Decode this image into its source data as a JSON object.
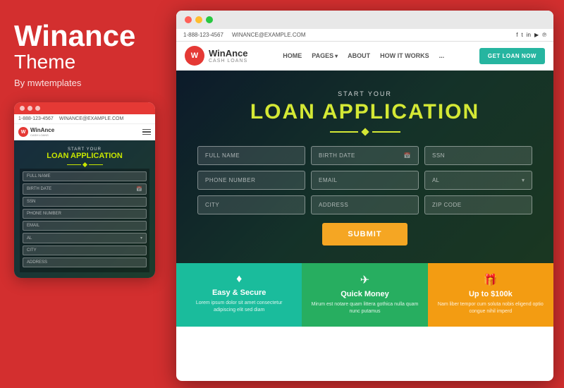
{
  "left": {
    "brand_title": "Winance",
    "brand_subtitle": "Theme",
    "by_text": "By mwtemplates"
  },
  "mobile": {
    "address_phone": "1-888-123-4567",
    "address_email": "WINANCE@EXAMPLE.COM",
    "logo_letter": "W",
    "logo_name": "WinAnce",
    "logo_sub": "CASH LOANS",
    "hero_start": "START YOUR",
    "hero_title": "LOAN APPLICATION",
    "fields": [
      "FULL NAME",
      "BIRTH DATE",
      "SSN",
      "PHONE NUMBER",
      "EMAIL",
      "AL",
      "CITY",
      "ADDRESS"
    ]
  },
  "browser": {
    "address_phone": "1-888-123-4567",
    "address_email": "WINANCE@EXAMPLE.COM",
    "social": [
      "f",
      "t",
      "in",
      "▶",
      "℗"
    ],
    "logo_letter": "W",
    "logo_name": "WinAnce",
    "logo_sub": "CASH LOANS",
    "nav_links": [
      "HOME",
      "PAGES",
      "ABOUT",
      "HOW IT WORKS",
      "..."
    ],
    "cta_label": "GET LOAN NOW",
    "hero_start": "START YOUR",
    "hero_title": "LOAN APPLICATION",
    "form": {
      "row1": [
        "FULL NAME",
        "BIRTH DATE",
        "SSN"
      ],
      "row2": [
        "PHONE NUMBER",
        "EMAIL",
        "AL"
      ],
      "row3": [
        "CITY",
        "ADDRESS",
        "ZIP CODE"
      ],
      "submit": "SUBMIT"
    },
    "cards": [
      {
        "icon": "♦",
        "title": "Easy & Secure",
        "text": "Lorem ipsum dolor sit amet consectetur adipiscing elit sed diam",
        "color": "teal"
      },
      {
        "icon": "✈",
        "title": "Quick Money",
        "text": "Mirum est notare quam littera gothica nulla quam nunc putamus",
        "color": "green"
      },
      {
        "icon": "🎁",
        "title": "Up to $100k",
        "text": "Nam liber tempor cum soluta nobis eligend optio congue nihil imperd",
        "color": "orange"
      }
    ]
  }
}
